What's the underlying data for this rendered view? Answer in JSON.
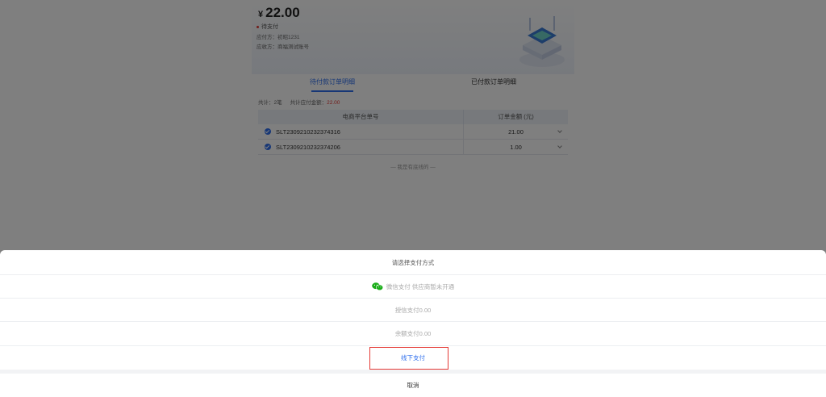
{
  "order": {
    "currency": "¥",
    "amount": "22.00",
    "status": "待支付",
    "payer_label": "应付方：",
    "payer_value": "初昭1231",
    "payee_label": "应收方：",
    "payee_value": "商福测试账号"
  },
  "tabs": [
    {
      "label": "待付款订单明细",
      "active": true
    },
    {
      "label": "已付款订单明细",
      "active": false
    }
  ],
  "summary": {
    "count_label": "共计：",
    "count_value": "2笔",
    "total_label": "共计应付金额：",
    "total_value": "22.00"
  },
  "table": {
    "headers": [
      "电商平台单号",
      "订单金额 (元)"
    ],
    "rows": [
      {
        "order_no": "SLT2309210232374316",
        "amount": "21.00"
      },
      {
        "order_no": "SLT2309210232374206",
        "amount": "1.00"
      }
    ],
    "end_text": "— 我是有底线的 —"
  },
  "payment_sheet": {
    "title": "请选择支付方式",
    "options": {
      "wechat": "微信支付 供应商暂未开通",
      "card": "授信支付0.00",
      "balance": "余额支付0.00",
      "offline": "线下支付"
    },
    "cancel": "取消"
  },
  "colors": {
    "accent": "#2f6fed",
    "danger": "#e53935",
    "wechat_green": "#1aad19",
    "mask": "rgba(0,0,0,0.5)"
  },
  "icons": [
    "wechat-icon",
    "check-icon",
    "chevron-down-icon",
    "status-dot-icon"
  ]
}
